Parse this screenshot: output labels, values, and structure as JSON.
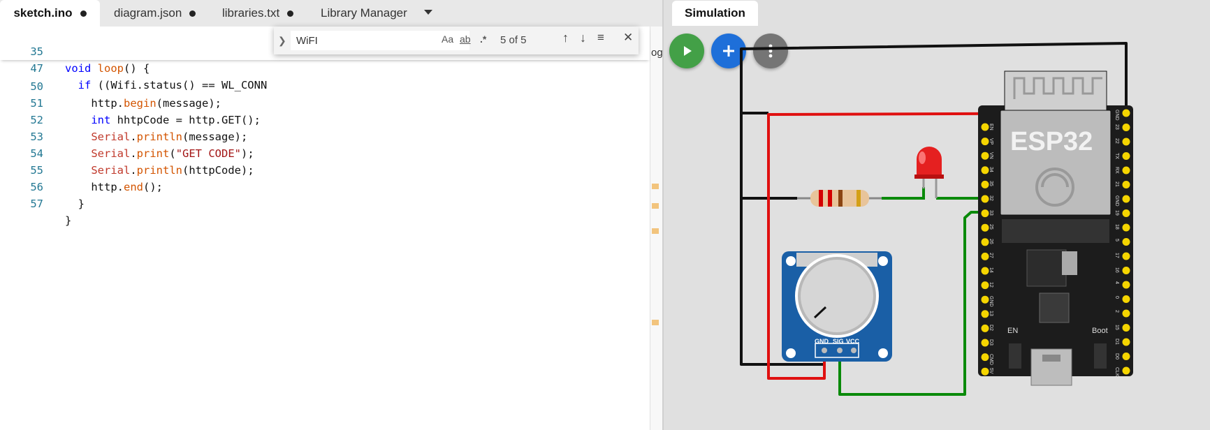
{
  "editor": {
    "tabs": [
      {
        "label": "sketch.ino",
        "modified": true,
        "active": true
      },
      {
        "label": "diagram.json",
        "modified": true,
        "active": false
      },
      {
        "label": "libraries.txt",
        "modified": true,
        "active": false
      },
      {
        "label": "Library Manager",
        "modified": false,
        "active": false
      }
    ],
    "sticky_lines": [
      {
        "num": "35",
        "text": "void loop() {"
      },
      {
        "num": "47",
        "text": "  if ((Wifi.status() == WL_CONN"
      }
    ],
    "code_lines": [
      {
        "num": "50",
        "text": "    http.begin(message);"
      },
      {
        "num": "51",
        "text": "    int hhtpCode = http.GET();"
      },
      {
        "num": "52",
        "text": "    Serial.println(message);"
      },
      {
        "num": "53",
        "text": "    Serial.print(\"GET CODE\");"
      },
      {
        "num": "54",
        "text": "    Serial.println(httpCode);"
      },
      {
        "num": "55",
        "text": "    http.end();"
      },
      {
        "num": "56",
        "text": "  }"
      },
      {
        "num": "57",
        "text": "}"
      }
    ],
    "overflow_peek": "og"
  },
  "find": {
    "query": "WiFI",
    "match_case": "Aa",
    "whole_word": "ab",
    "regex": ".*",
    "count": "5 of 5"
  },
  "simulation": {
    "tab_label": "Simulation",
    "board_label": "ESP32",
    "pot_pins": [
      "GND",
      "SIG",
      "VCC"
    ],
    "button_en": "EN",
    "button_boot": "Boot",
    "left_pins": [
      "EN",
      "VP",
      "VN",
      "34",
      "35",
      "32",
      "33",
      "25",
      "26",
      "27",
      "14",
      "12",
      "GND",
      "13",
      "D2",
      "D3",
      "CMD",
      "5V"
    ],
    "right_pins": [
      "GND",
      "23",
      "22",
      "TX",
      "RX",
      "21",
      "GND",
      "19",
      "18",
      "5",
      "17",
      "16",
      "4",
      "0",
      "2",
      "15",
      "D1",
      "D0",
      "CLK"
    ],
    "wire_colors": {
      "black": "#111111",
      "red": "#e01010",
      "green": "#0a8a0a"
    },
    "button_colors": {
      "play": "#43a047",
      "add": "#1e6fd9",
      "menu": "#757575"
    }
  }
}
